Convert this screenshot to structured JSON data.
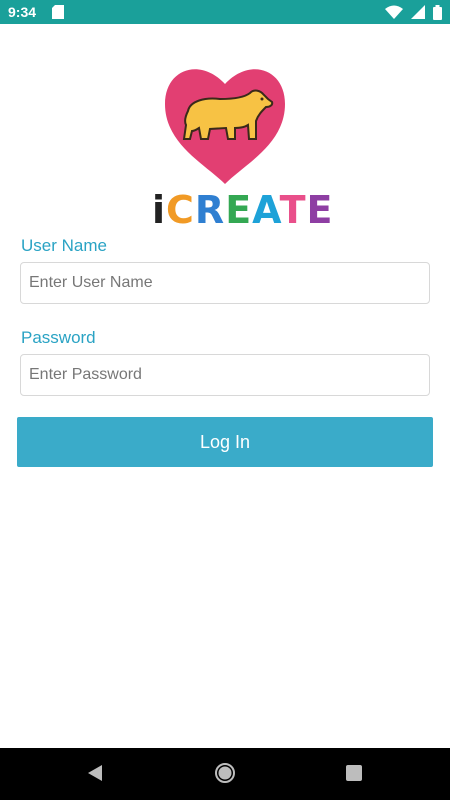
{
  "status_bar": {
    "time": "9:34",
    "icons": [
      "sd-card-icon",
      "wifi-icon",
      "signal-icon",
      "battery-icon"
    ]
  },
  "logo": {
    "text_letters": [
      "i",
      "C",
      "R",
      "E",
      "A",
      "T",
      "E"
    ],
    "letter_colors": [
      "#222222",
      "#f19a25",
      "#2f7fd1",
      "#34a853",
      "#1ea2d8",
      "#e94f8a",
      "#8e3ea3"
    ],
    "heart_color": "#e23f72",
    "bear_color": "#f7c244"
  },
  "form": {
    "username_label": "User Name",
    "username_placeholder": "Enter User Name",
    "password_label": "Password",
    "password_placeholder": "Enter Password",
    "login_label": "Log In"
  },
  "nav_bar": {
    "buttons": [
      "back-icon",
      "home-icon",
      "recents-icon"
    ]
  },
  "colors": {
    "status_bar": "#1aa09a",
    "accent": "#2aa3c4",
    "button": "#3aabc9"
  }
}
